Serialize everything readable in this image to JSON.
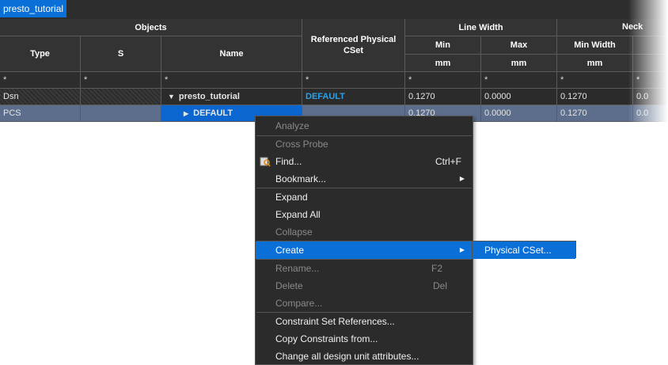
{
  "tab": {
    "label": "presto_tutorial"
  },
  "headers": {
    "objects": "Objects",
    "type": "Type",
    "s": "S",
    "name": "Name",
    "ref_cset": "Referenced Physical CSet",
    "line_width": "Line Width",
    "min": "Min",
    "max": "Max",
    "neck": "Neck",
    "min_width": "Min Width",
    "mm": "mm"
  },
  "filter": "*",
  "rows": [
    {
      "type": "Dsn",
      "s": "",
      "name": "presto_tutorial",
      "name_icon": "triangle-down",
      "ref": "DEFAULT",
      "lw_min": "0.1270",
      "lw_max": "0.0000",
      "neck_min": "0.1270",
      "extra": "0.0"
    },
    {
      "type": "PCS",
      "s": "",
      "name": "DEFAULT",
      "name_icon": "triangle-right",
      "ref": "",
      "lw_min": "0.1270",
      "lw_max": "0.0000",
      "neck_min": "0.1270",
      "extra": "0.0"
    }
  ],
  "context_menu": {
    "analyze": "Analyze",
    "cross_probe": "Cross Probe",
    "find": "Find...",
    "find_shortcut": "Ctrl+F",
    "bookmark": "Bookmark...",
    "expand": "Expand",
    "expand_all": "Expand All",
    "collapse": "Collapse",
    "create": "Create",
    "rename": "Rename...",
    "rename_shortcut": "F2",
    "delete": "Delete",
    "delete_shortcut": "Del",
    "compare": "Compare...",
    "constraint_refs": "Constraint Set References...",
    "copy_constraints": "Copy Constraints from...",
    "change_attrs": "Change all design unit attributes..."
  },
  "submenu": {
    "physical_cset": "Physical CSet..."
  },
  "colors": {
    "accent": "#0a6fd6",
    "link_blue": "#2fa0e6",
    "grid_bg": "#2d2d2d",
    "selected_row": "#5d6e8c"
  }
}
